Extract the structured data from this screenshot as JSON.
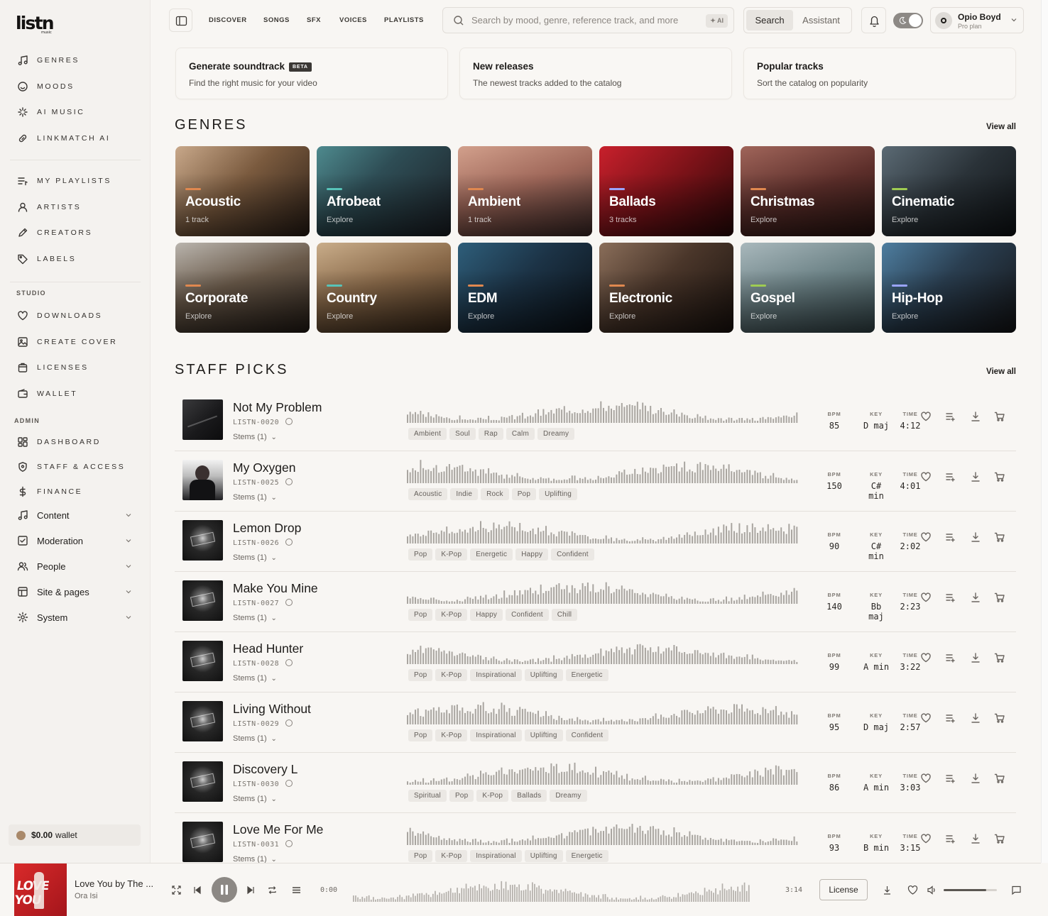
{
  "logo": {
    "text": "listn",
    "tag": "music"
  },
  "sidebar": {
    "main": [
      {
        "label": "Genres",
        "icon": "music-note-icon"
      },
      {
        "label": "Moods",
        "icon": "smiley-icon"
      },
      {
        "label": "AI Music",
        "icon": "sparkle-icon"
      },
      {
        "label": "Linkmatch AI",
        "icon": "link-icon"
      }
    ],
    "library": [
      {
        "label": "My Playlists",
        "icon": "playlist-icon"
      },
      {
        "label": "Artists",
        "icon": "user-icon"
      },
      {
        "label": "Creators",
        "icon": "pen-icon"
      },
      {
        "label": "Labels",
        "icon": "tag-icon"
      }
    ],
    "studio_heading": "STUDIO",
    "studio": [
      {
        "label": "Downloads",
        "icon": "heart-icon"
      },
      {
        "label": "Create Cover",
        "icon": "image-icon"
      },
      {
        "label": "Licenses",
        "icon": "bag-icon"
      },
      {
        "label": "Wallet",
        "icon": "wallet-icon"
      }
    ],
    "admin_heading": "ADMIN",
    "admin": [
      {
        "label": "Dashboard",
        "icon": "grid-icon"
      },
      {
        "label": "Staff & Access",
        "icon": "shield-icon"
      },
      {
        "label": "Finance",
        "icon": "dollar-icon"
      }
    ],
    "groups": [
      {
        "label": "Content",
        "icon": "music-note-icon"
      },
      {
        "label": "Moderation",
        "icon": "check-square-icon"
      },
      {
        "label": "People",
        "icon": "people-icon"
      },
      {
        "label": "Site & pages",
        "icon": "layout-icon"
      },
      {
        "label": "System",
        "icon": "gear-icon"
      }
    ],
    "wallet": {
      "amount": "$0.00",
      "label": "wallet"
    }
  },
  "topbar": {
    "tabs": [
      "DISCOVER",
      "SONGS",
      "SFX",
      "VOICES",
      "PLAYLISTS"
    ],
    "search_placeholder": "Search by mood, genre, reference track, and more",
    "ai_badge": "✦ AI",
    "mode_search": "Search",
    "mode_assistant": "Assistant",
    "user_name": "Opio Boyd",
    "user_plan": "Pro plan"
  },
  "quick_cards": [
    {
      "title": "Generate soundtrack",
      "badge": "BETA",
      "desc": "Find the right music for your video"
    },
    {
      "title": "New releases",
      "badge": "",
      "desc": "The newest tracks added to the catalog"
    },
    {
      "title": "Popular tracks",
      "badge": "",
      "desc": "Sort the catalog on popularity"
    }
  ],
  "genres": {
    "title": "GENRES",
    "view_all": "View all",
    "items": [
      {
        "name": "Acoustic",
        "sub": "1 track",
        "accent": "#e0884f",
        "bg": "linear-gradient(135deg,#c8a88a 0%,#7a5a3e 45%,#2a1e16 100%)"
      },
      {
        "name": "Afrobeat",
        "sub": "Explore",
        "accent": "#57c3b8",
        "bg": "linear-gradient(135deg,#4e8a8e 0%,#2e4d55 40%,#1b1f25 100%)"
      },
      {
        "name": "Ambient",
        "sub": "1 track",
        "accent": "#e0884f",
        "bg": "linear-gradient(160deg,#d2a08c 0%,#a0685a 45%,#3e2a28 100%)"
      },
      {
        "name": "Ballads",
        "sub": "3 tracks",
        "accent": "#9aa4ff",
        "bg": "linear-gradient(135deg,#c8202c 0%,#7a1218 50%,#2a0808 100%)"
      },
      {
        "name": "Christmas",
        "sub": "Explore",
        "accent": "#e0884f",
        "bg": "linear-gradient(160deg,#a0655a 0%,#5c2e2a 50%,#2a1512 100%)"
      },
      {
        "name": "Cinematic",
        "sub": "Explore",
        "accent": "#9fcc52",
        "bg": "linear-gradient(135deg,#5b6a74 0%,#2a3238 50%,#0f1316 100%)"
      },
      {
        "name": "Corporate",
        "sub": "Explore",
        "accent": "#e0884f",
        "bg": "linear-gradient(160deg,#b9b4ad 0%,#6a5a4a 45%,#241c16 100%)"
      },
      {
        "name": "Country",
        "sub": "Explore",
        "accent": "#57c3b8",
        "bg": "linear-gradient(160deg,#c9ad8a 0%,#8a6a4a 45%,#3a2818 100%)"
      },
      {
        "name": "EDM",
        "sub": "Explore",
        "accent": "#e0884f",
        "bg": "linear-gradient(135deg,#2e5e7a 0%,#1c3346 45%,#0a1016 100%)"
      },
      {
        "name": "Electronic",
        "sub": "Explore",
        "accent": "#e0884f",
        "bg": "linear-gradient(135deg,#8a6e5a 0%,#4a362a 45%,#1a120e 100%)"
      },
      {
        "name": "Gospel",
        "sub": "Explore",
        "accent": "#9fcc52",
        "bg": "linear-gradient(160deg,#a9b8bc 0%,#6e8488 45%,#34464a 100%)"
      },
      {
        "name": "Hip-Hop",
        "sub": "Explore",
        "accent": "#9aa4ff",
        "bg": "linear-gradient(135deg,#4e7ea0 0%,#2a3e50 45%,#141416 100%)"
      }
    ]
  },
  "staff_picks": {
    "title": "STAFF PICKS",
    "view_all": "View all",
    "headers": {
      "bpm": "BPM",
      "key": "KEY",
      "time": "TIME"
    },
    "tracks": [
      {
        "title": "Not My Problem",
        "code": "LISTN-0020",
        "stems": "Stems (1)",
        "tags": [
          "Ambient",
          "Soul",
          "Rap",
          "Calm",
          "Dreamy"
        ],
        "bpm": "85",
        "key": "D maj",
        "time": "4:12",
        "cover": "dark"
      },
      {
        "title": "My Oxygen",
        "code": "LISTN-0025",
        "stems": "Stems (1)",
        "tags": [
          "Acoustic",
          "Indie",
          "Rock",
          "Pop",
          "Uplifting"
        ],
        "bpm": "150",
        "key": "C# min",
        "time": "4:01",
        "cover": "portrait"
      },
      {
        "title": "Lemon Drop",
        "code": "LISTN-0026",
        "stems": "Stems (1)",
        "tags": [
          "Pop",
          "K-Pop",
          "Energetic",
          "Happy",
          "Confident"
        ],
        "bpm": "90",
        "key": "C# min",
        "time": "2:02",
        "cover": "splash"
      },
      {
        "title": "Make You Mine",
        "code": "LISTN-0027",
        "stems": "Stems (1)",
        "tags": [
          "Pop",
          "K-Pop",
          "Happy",
          "Confident",
          "Chill"
        ],
        "bpm": "140",
        "key": "Bb maj",
        "time": "2:23",
        "cover": "splash"
      },
      {
        "title": "Head Hunter",
        "code": "LISTN-0028",
        "stems": "Stems (1)",
        "tags": [
          "Pop",
          "K-Pop",
          "Inspirational",
          "Uplifting",
          "Energetic"
        ],
        "bpm": "99",
        "key": "A min",
        "time": "3:22",
        "cover": "splash"
      },
      {
        "title": "Living Without",
        "code": "LISTN-0029",
        "stems": "Stems (1)",
        "tags": [
          "Pop",
          "K-Pop",
          "Inspirational",
          "Uplifting",
          "Confident"
        ],
        "bpm": "95",
        "key": "D maj",
        "time": "2:57",
        "cover": "splash"
      },
      {
        "title": "Discovery L",
        "code": "LISTN-0030",
        "stems": "Stems (1)",
        "tags": [
          "Spiritual",
          "Pop",
          "K-Pop",
          "Ballads",
          "Dreamy"
        ],
        "bpm": "86",
        "key": "A min",
        "time": "3:03",
        "cover": "splash"
      },
      {
        "title": "Love Me For Me",
        "code": "LISTN-0031",
        "stems": "Stems (1)",
        "tags": [
          "Pop",
          "K-Pop",
          "Inspirational",
          "Uplifting",
          "Energetic"
        ],
        "bpm": "93",
        "key": "B min",
        "time": "3:15",
        "cover": "splash"
      }
    ]
  },
  "player": {
    "title": "Love You by The ...",
    "artist": "Ora Isi",
    "cover_text": "LOVE YOU",
    "elapsed": "0:00",
    "duration": "3:14",
    "license_label": "License",
    "volume": 0.8,
    "progress": 0
  }
}
